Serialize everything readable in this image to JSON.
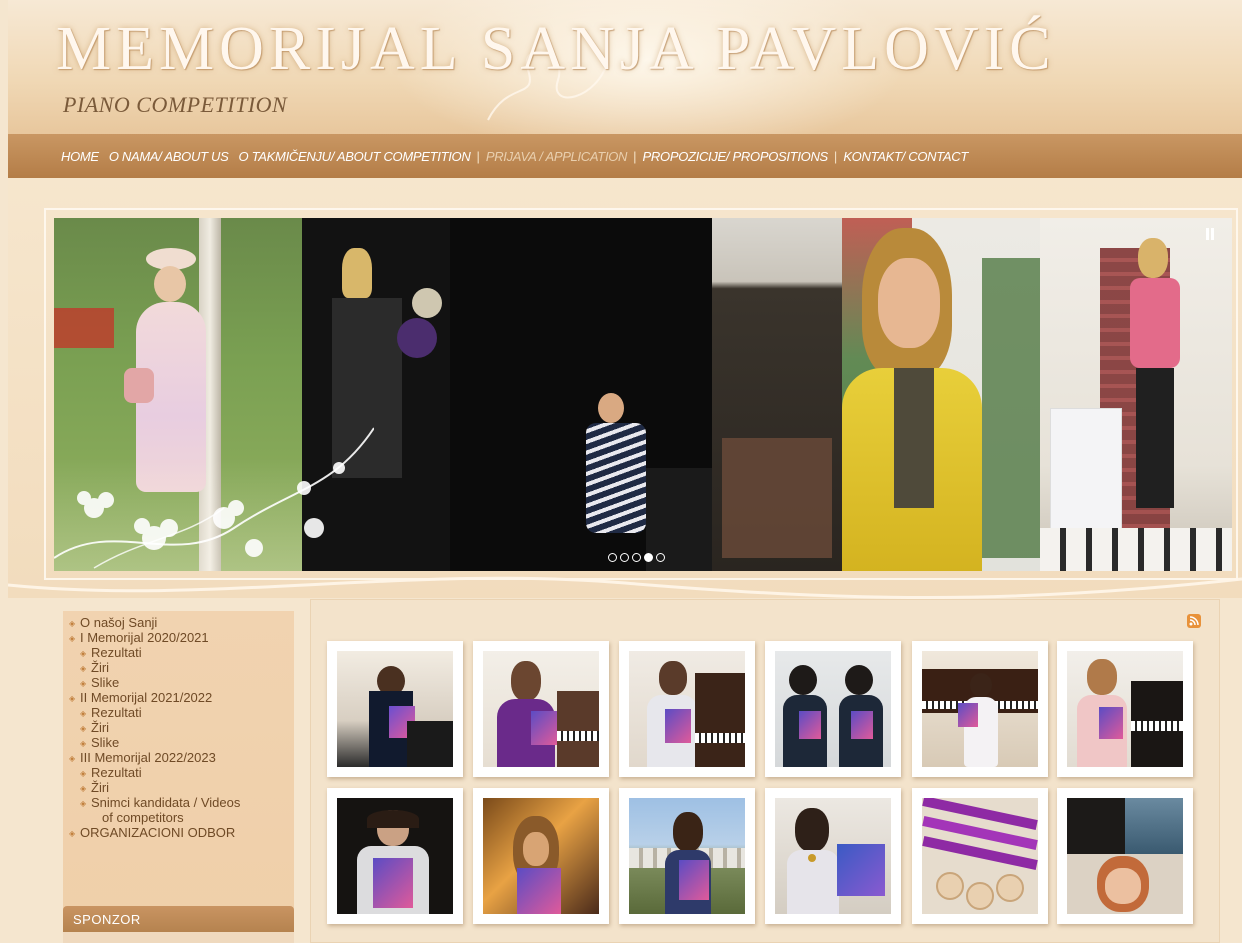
{
  "header": {
    "title": "MEMORIJAL SANJA PAVLOVIĆ",
    "subtitle": "PIANO COMPETITION"
  },
  "nav": {
    "items": [
      {
        "label": "HOME"
      },
      {
        "label": "O NAMA/ ABOUT US"
      },
      {
        "label": "O TAKMIČENJU/ ABOUT COMPETITION"
      },
      {
        "label": "PRIJAVA / APPLICATION",
        "active": true
      },
      {
        "label": "PROPOZICIJE/ PROPOSITIONS"
      },
      {
        "label": "KONTAKT/ CONTACT"
      }
    ]
  },
  "slider": {
    "dot_count": 5,
    "active_dot": 4,
    "pause_icon": "pause-icon"
  },
  "sidebar": {
    "menu": [
      {
        "label": "O našoj Sanji",
        "level": 0
      },
      {
        "label": "I Memorijal 2020/2021",
        "level": 0
      },
      {
        "label": "Rezultati",
        "level": 1
      },
      {
        "label": "Žiri",
        "level": 1
      },
      {
        "label": "Slike",
        "level": 1
      },
      {
        "label": "II Memorijal 2021/2022",
        "level": 0
      },
      {
        "label": "Rezultati",
        "level": 1
      },
      {
        "label": "Žiri",
        "level": 1
      },
      {
        "label": "Slike",
        "level": 1
      },
      {
        "label": "III Memorijal 2022/2023",
        "level": 0
      },
      {
        "label": "Rezultati",
        "level": 1
      },
      {
        "label": "Žiri",
        "level": 1
      },
      {
        "label": "Snimci kandidata / Videos",
        "label2": "of competitors",
        "level": 1
      },
      {
        "label": "ORGANIZACIONI ODBOR",
        "level": 0
      }
    ],
    "sponsor_title": "SPONZOR"
  },
  "gallery": {
    "rss_icon": "rss-icon",
    "thumb_count": 12
  },
  "colors": {
    "nav_bg": "#b47d47",
    "page_bg": "#f5e6cf",
    "menu_text": "#6f4a26",
    "accent": "#e8923a"
  }
}
